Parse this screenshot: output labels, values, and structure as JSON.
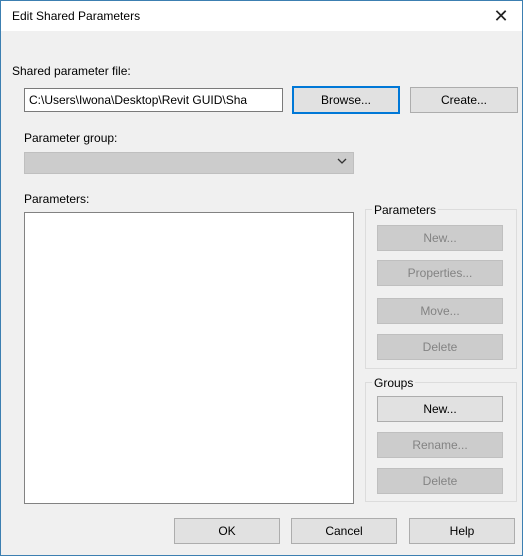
{
  "window": {
    "title": "Edit Shared Parameters",
    "close_icon": "close-icon"
  },
  "shared_file": {
    "label": "Shared parameter file:",
    "path_value": "C:\\Users\\Iwona\\Desktop\\Revit GUID\\Sha",
    "browse_label": "Browse...",
    "create_label": "Create..."
  },
  "parameter_group": {
    "label": "Parameter group:",
    "selected_value": ""
  },
  "parameters_list": {
    "label": "Parameters:"
  },
  "parameters_box": {
    "title": "Parameters",
    "new_label": "New...",
    "properties_label": "Properties...",
    "move_label": "Move...",
    "delete_label": "Delete"
  },
  "groups_box": {
    "title": "Groups",
    "new_label": "New...",
    "rename_label": "Rename...",
    "delete_label": "Delete"
  },
  "footer": {
    "ok_label": "OK",
    "cancel_label": "Cancel",
    "help_label": "Help"
  },
  "colors": {
    "accent": "#0078d7",
    "window_border": "#3c7fb1",
    "disabled_bg": "#cccccc",
    "disabled_text": "#838383"
  }
}
